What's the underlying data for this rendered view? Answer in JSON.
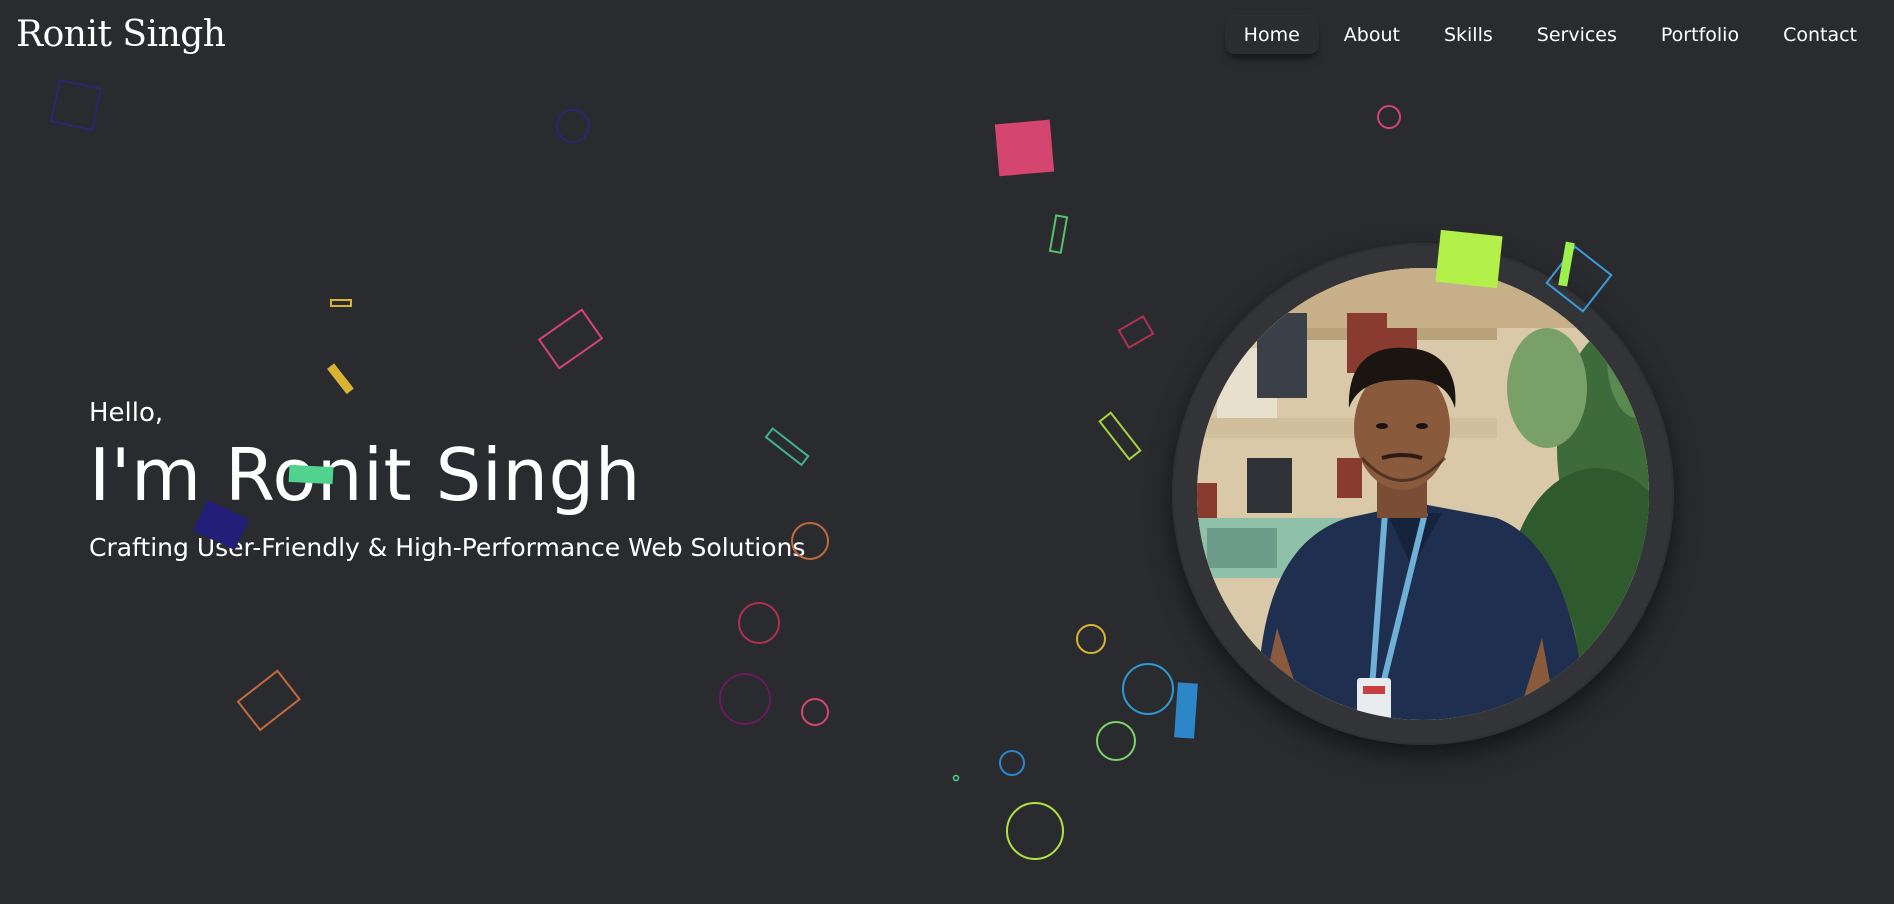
{
  "header": {
    "logo": "Ronit Singh",
    "nav": [
      {
        "label": "Home",
        "active": true
      },
      {
        "label": "About",
        "active": false
      },
      {
        "label": "Skills",
        "active": false
      },
      {
        "label": "Services",
        "active": false
      },
      {
        "label": "Portfolio",
        "active": false
      },
      {
        "label": "Contact",
        "active": false
      }
    ]
  },
  "hero": {
    "greeting": "Hello,",
    "title": "I'm Ronit Singh",
    "tagline": "Crafting User-Friendly & High-Performance Web Solutions"
  },
  "profile": {
    "image_alt": "profile-photo"
  },
  "colors": {
    "background": "#2a2b2f",
    "text": "#ffffff",
    "frame": "#333437"
  }
}
